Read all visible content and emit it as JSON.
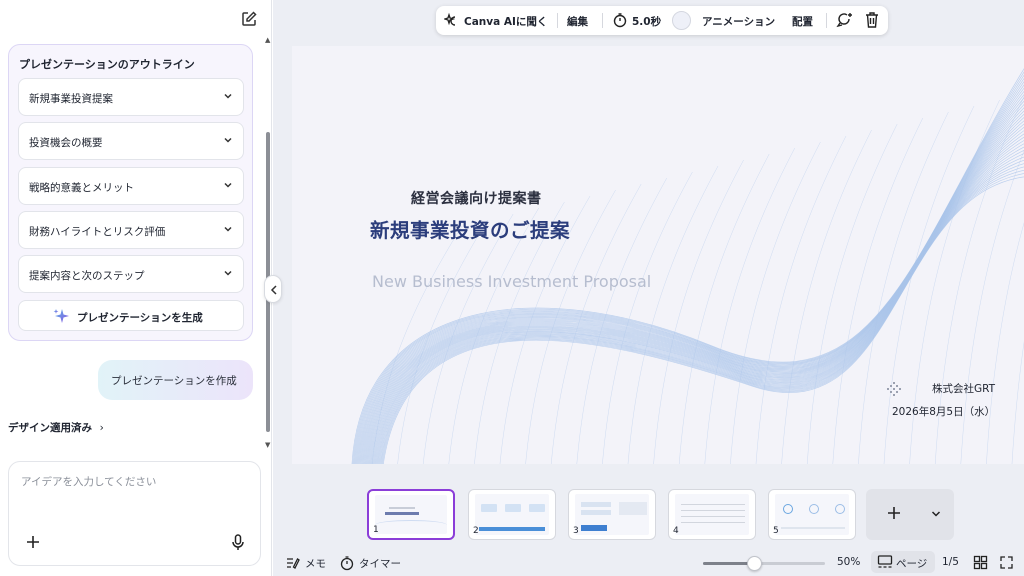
{
  "sidebar": {
    "outline_title": "プレゼンテーションのアウトライン",
    "outline_items": [
      {
        "label": "新規事業投資提案"
      },
      {
        "label": "投資機会の概要"
      },
      {
        "label": "戦略的意義とメリット"
      },
      {
        "label": "財務ハイライトとリスク評価"
      },
      {
        "label": "提案内容と次のステップ"
      }
    ],
    "generate_label": "プレゼンテーションを生成",
    "create_bubble": "プレゼンテーションを作成",
    "design_applied": "デザイン適用済み",
    "design_chevron": "›",
    "idea_placeholder": "アイデアを入力してください"
  },
  "toolbar": {
    "canva_ai": "Canva AIに聞く",
    "edit": "編集",
    "duration": "5.0秒",
    "animation": "アニメーション",
    "position": "配置"
  },
  "slide": {
    "subtitle": "経営会議向け提案書",
    "title": "新規事業投資のご提案",
    "english_title": "New Business Investment Proposal",
    "company": "株式会社GRT",
    "date": "2026年8月5日（水）"
  },
  "pages": [
    {
      "number": "1"
    },
    {
      "number": "2"
    },
    {
      "number": "3"
    },
    {
      "number": "4"
    },
    {
      "number": "5"
    }
  ],
  "bottom_bar": {
    "notes": "メモ",
    "timer": "タイマー",
    "zoom": "50%",
    "zoom_level": 0.42,
    "page_view": "ページ",
    "page_count": "1/5"
  },
  "colors": {
    "accent_purple": "#8b3dd8",
    "slide_title": "#2b3d7c",
    "wave": "#aac4ea"
  }
}
